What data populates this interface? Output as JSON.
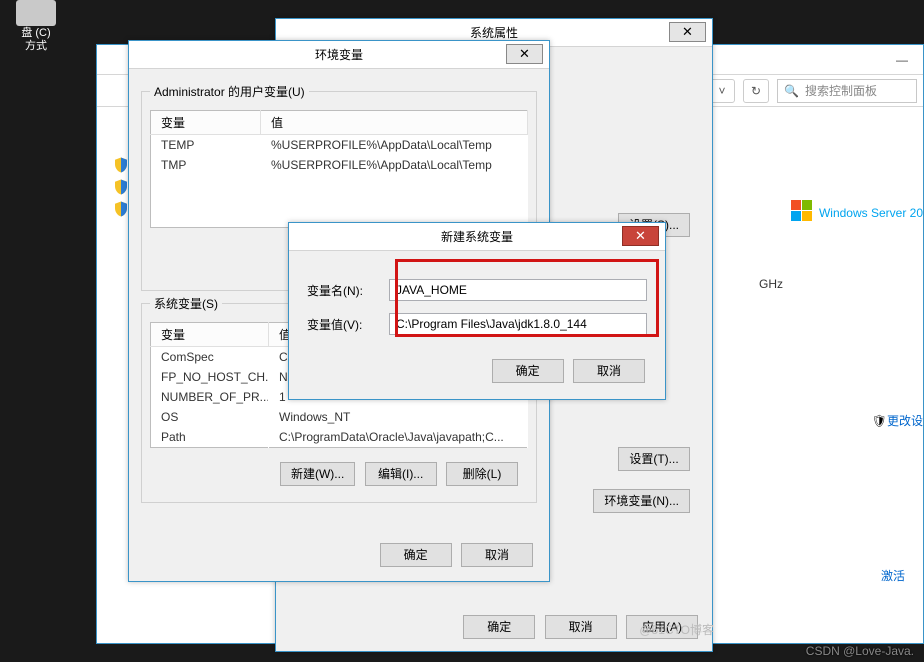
{
  "desktop_icon": {
    "label_line1": "盘 (C)",
    "label_line2": "方式"
  },
  "sysprops": {
    "title": "系统属性",
    "close": "✕",
    "settings_s": "设置(S)...",
    "settings_t": "设置(T)...",
    "envvars_btn": "环境变量(N)...",
    "ok": "确定",
    "cancel": "取消",
    "apply": "应用(A)"
  },
  "envvars": {
    "title": "环境变量",
    "close": "✕",
    "user_group": "Administrator 的用户变量(U)",
    "sys_group": "系统变量(S)",
    "col_name": "变量",
    "col_value": "值",
    "user_rows": [
      {
        "name": "TEMP",
        "value": "%USERPROFILE%\\AppData\\Local\\Temp"
      },
      {
        "name": "TMP",
        "value": "%USERPROFILE%\\AppData\\Local\\Temp"
      }
    ],
    "sys_rows": [
      {
        "name": "ComSpec",
        "value": "C:\\"
      },
      {
        "name": "FP_NO_HOST_CH...",
        "value": "NO"
      },
      {
        "name": "NUMBER_OF_PR...",
        "value": "1"
      },
      {
        "name": "OS",
        "value": "Windows_NT"
      },
      {
        "name": "Path",
        "value": "C:\\ProgramData\\Oracle\\Java\\javapath;C..."
      }
    ],
    "new_btn_partial": "新",
    "new": "新建(W)...",
    "edit": "编辑(I)...",
    "del": "删除(L)",
    "ok": "确定",
    "cancel": "取消"
  },
  "newvar": {
    "title": "新建系统变量",
    "close": "✕",
    "name_label": "变量名(N):",
    "value_label": "变量值(V):",
    "name_value": "JAVA_HOME",
    "value_value": "C:\\Program Files\\Java\\jdk1.8.0_144",
    "ok": "确定",
    "cancel": "取消"
  },
  "shell": {
    "search_placeholder": "搜索控制面板",
    "brand": "Windows Server 20",
    "info": "GHz",
    "change": "更改设",
    "activate": "激活"
  },
  "watermarks": {
    "csdn": "CSDN @Love-Java.",
    "cto": "@51CTO博客"
  }
}
